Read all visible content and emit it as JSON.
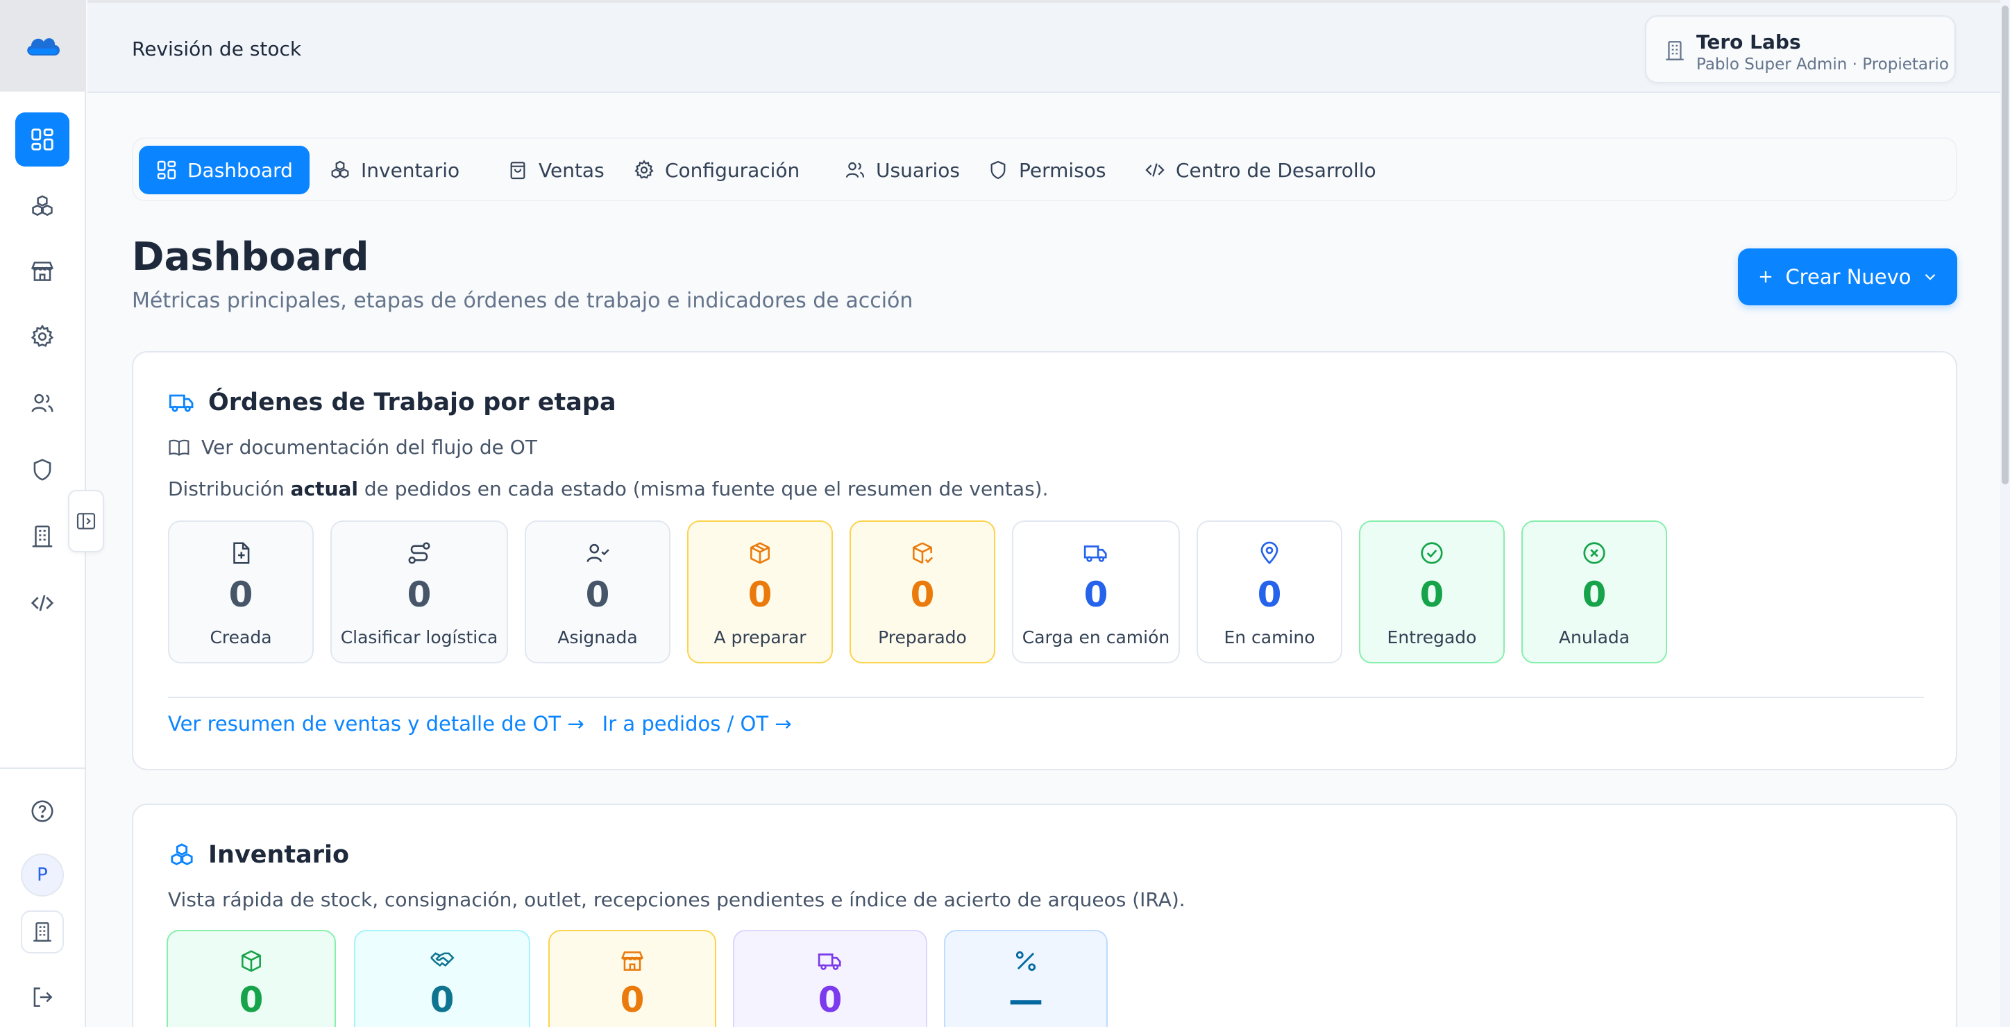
{
  "header": {
    "breadcrumb": "Revisión de stock",
    "org_name": "Tero Labs",
    "org_sub": "Pablo Super Admin · Propietario"
  },
  "sidebar": {
    "avatar_initial": "P"
  },
  "tabs": [
    {
      "label": "Dashboard",
      "icon": "dashboard-icon"
    },
    {
      "label": "Inventario",
      "icon": "boxes-icon"
    },
    {
      "label": "Ventas",
      "icon": "shopping-bag-icon"
    },
    {
      "label": "Configuración",
      "icon": "gear-icon"
    },
    {
      "label": "Usuarios",
      "icon": "users-icon"
    },
    {
      "label": "Permisos",
      "icon": "shield-icon"
    },
    {
      "label": "Centro de Desarrollo",
      "icon": "code-icon"
    }
  ],
  "page": {
    "title": "Dashboard",
    "subtitle": "Métricas principales, etapas de órdenes de trabajo e indicadores de acción",
    "create_label": "Crear Nuevo"
  },
  "ot_card": {
    "title": "Órdenes de Trabajo por etapa",
    "doc_link": "Ver documentación del flujo de OT",
    "desc_pre": "Distribución ",
    "desc_bold": "actual",
    "desc_post": " de pedidos en cada estado (misma fuente que el resumen de ventas).",
    "stages": [
      {
        "label": "Creada",
        "count": "0"
      },
      {
        "label": "Clasificar logística",
        "count": "0"
      },
      {
        "label": "Asignada",
        "count": "0"
      },
      {
        "label": "A preparar",
        "count": "0"
      },
      {
        "label": "Preparado",
        "count": "0"
      },
      {
        "label": "Carga en camión",
        "count": "0"
      },
      {
        "label": "En camino",
        "count": "0"
      },
      {
        "label": "Entregado",
        "count": "0"
      },
      {
        "label": "Anulada",
        "count": "0"
      }
    ],
    "link_sales": "Ver resumen de ventas y detalle de OT →",
    "link_orders": "Ir a pedidos / OT →"
  },
  "inv_card": {
    "title": "Inventario",
    "desc": "Vista rápida de stock, consignación, outlet, recepciones pendientes e índice de acierto de arqueos (IRA).",
    "stats": [
      {
        "count": "0",
        "color": "#16a34a"
      },
      {
        "count": "0",
        "color": "#0e7490"
      },
      {
        "count": "0",
        "color": "#ea7a0c"
      },
      {
        "count": "0",
        "color": "#7c3aed"
      },
      {
        "count": "—",
        "color": "#0369a1"
      }
    ]
  },
  "colors": {
    "accent": "#0a84ff",
    "sidebar_bg": "#ffffff",
    "amber": "#ea7a0c",
    "green": "#16a34a"
  }
}
